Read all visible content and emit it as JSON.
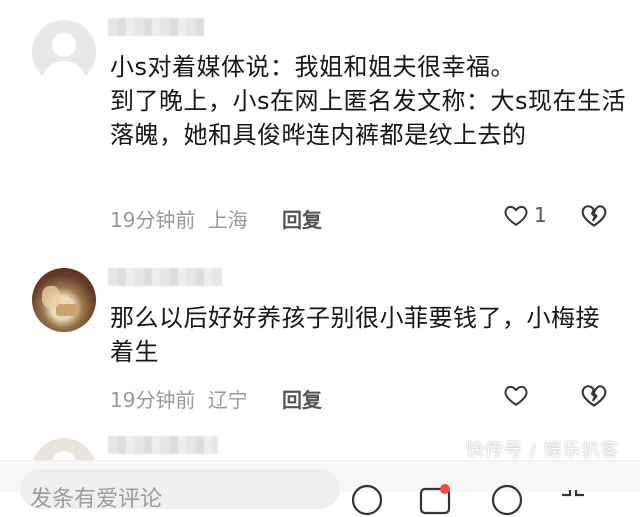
{
  "comments": [
    {
      "text": "小s对着媒体说：我姐和姐夫很幸福。\n到了晚上，小s在网上匿名发文称：大s现在生活落魄，她和具俊晔连内裤都是纹上去的",
      "time": "19分钟前",
      "location": "上海",
      "reply_label": "回复",
      "like_count": "1"
    },
    {
      "text": "那么以后好好养孩子别很小菲要钱了，小梅接着生",
      "time": "19分钟前",
      "location": "辽宁",
      "reply_label": "回复",
      "like_count": ""
    }
  ],
  "bottom_bar": {
    "placeholder": "发条有爱评论"
  },
  "watermark": "快传号 / 娱乐扒客"
}
